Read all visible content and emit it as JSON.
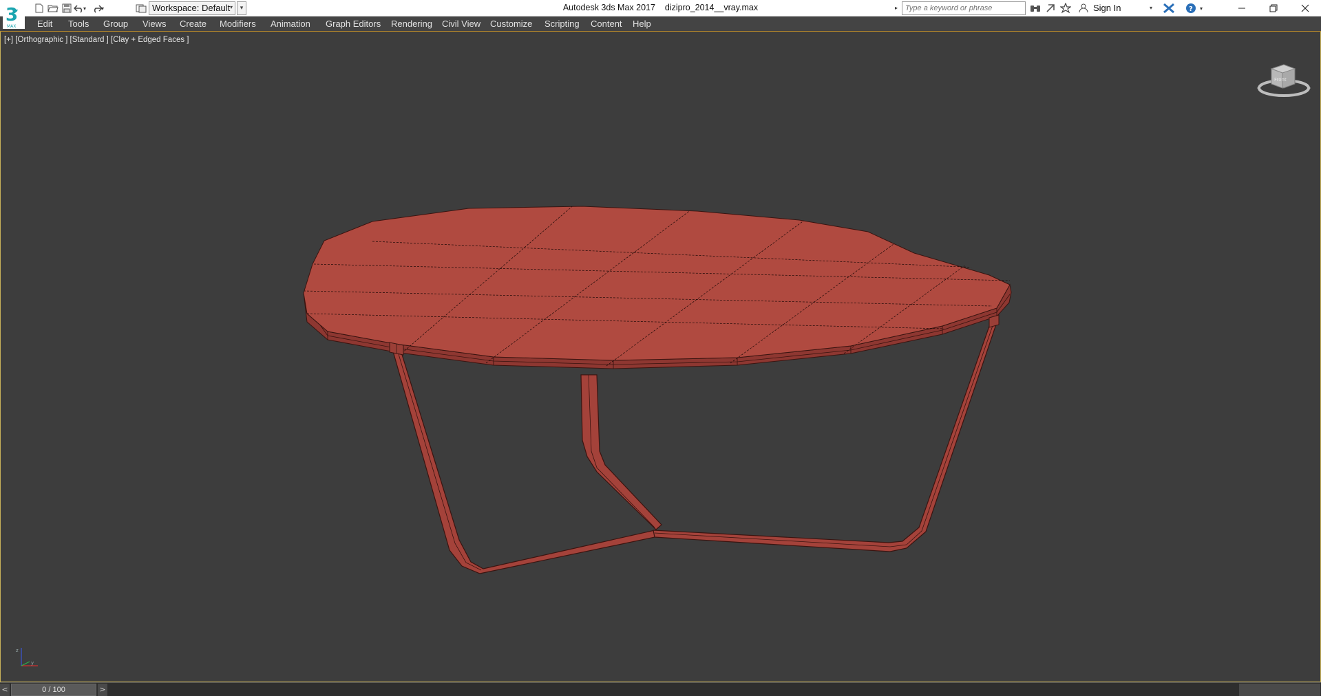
{
  "app": {
    "title": "Autodesk 3ds Max 2017",
    "filename": "dizipro_2014__vray.max"
  },
  "toolbar": {
    "workspace_label": "Workspace: Default",
    "search_placeholder": "Type a keyword or phrase",
    "sign_in": "Sign In"
  },
  "menu": [
    "Edit",
    "Tools",
    "Group",
    "Views",
    "Create",
    "Modifiers",
    "Animation",
    "Graph Editors",
    "Rendering",
    "Civil View",
    "Customize",
    "Scripting",
    "Content",
    "Help"
  ],
  "viewport": {
    "label": "[+] [Orthographic ] [Standard ] [Clay + Edged Faces ]",
    "viewcube_face": "Front",
    "object_color": "#b04a40"
  },
  "timeline": {
    "prev": "<",
    "frame_display": "0 / 100",
    "next": ">"
  },
  "colors": {
    "menubar": "#444444",
    "viewport_bg": "#3d3d3d",
    "viewport_border": "#c8b25a",
    "accent_logo": "#1aa5b0"
  }
}
